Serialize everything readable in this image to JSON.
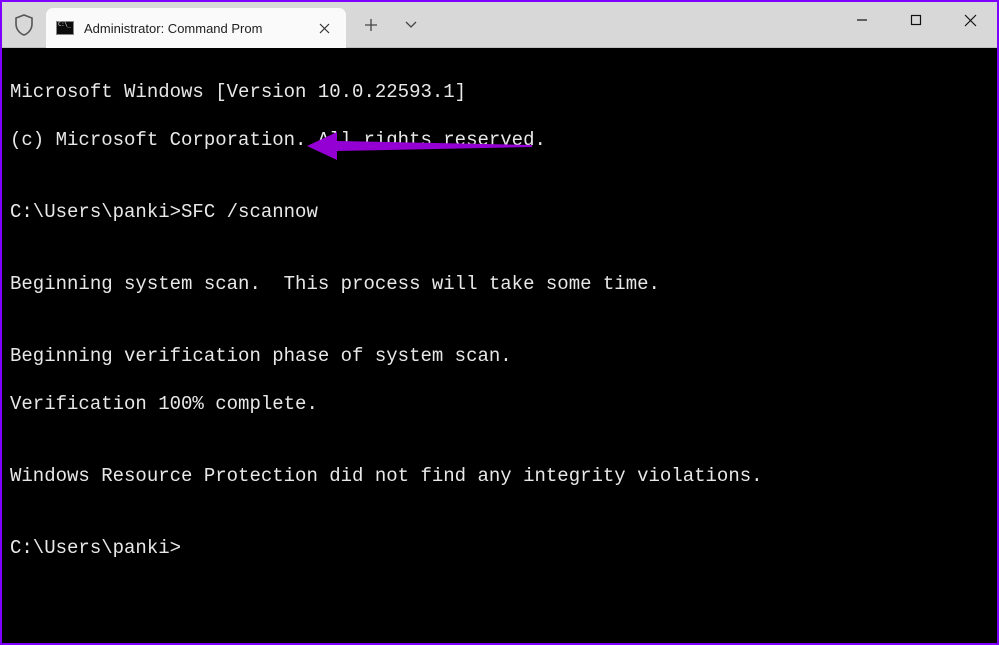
{
  "titlebar": {
    "tab_title": "Administrator: Command Prom",
    "tab_icon_name": "cmd-icon",
    "shield_icon_name": "shield-icon",
    "new_tab_icon_name": "plus-icon",
    "dropdown_icon_name": "chevron-down-icon",
    "close_tab_icon_name": "close-icon",
    "minimize_icon_name": "minimize-icon",
    "maximize_icon_name": "maximize-icon",
    "window_close_icon_name": "close-icon"
  },
  "terminal": {
    "lines": {
      "l0": "Microsoft Windows [Version 10.0.22593.1]",
      "l1": "(c) Microsoft Corporation. All rights reserved.",
      "l2": "",
      "l3_prompt": "C:\\Users\\panki>",
      "l3_cmd": "SFC /scannow",
      "l4": "",
      "l5": "Beginning system scan.  This process will take some time.",
      "l6": "",
      "l7": "Beginning verification phase of system scan.",
      "l8": "Verification 100% complete.",
      "l9": "",
      "l10": "Windows Resource Protection did not find any integrity violations.",
      "l11": "",
      "l12_prompt": "C:\\Users\\panki>"
    }
  },
  "annotation": {
    "arrow_color": "#9400D3"
  }
}
